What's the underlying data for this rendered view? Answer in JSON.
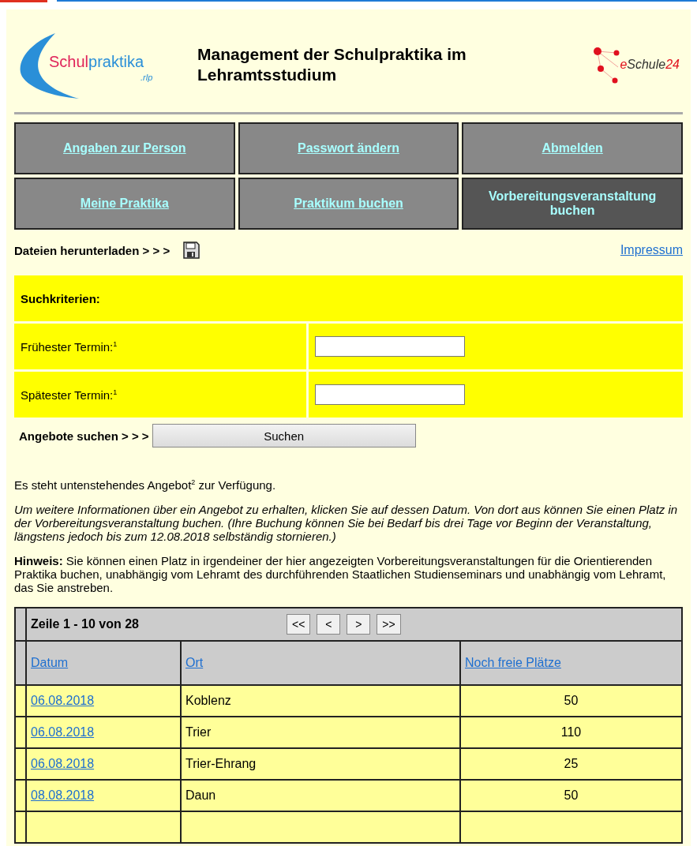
{
  "header": {
    "logo_left": {
      "main_a": "Schul",
      "main_b": "praktika",
      "sub": ".rlp"
    },
    "title": "Management der Schulpraktika im Lehramtsstudium",
    "logo_right": {
      "prefix": "e",
      "name": "Schule",
      "suffix": "24"
    }
  },
  "nav": [
    {
      "label": "Angaben zur Person",
      "selected": false
    },
    {
      "label": "Passwort ändern",
      "selected": false
    },
    {
      "label": "Abmelden",
      "selected": false
    },
    {
      "label": "Meine Praktika",
      "selected": false
    },
    {
      "label": "Praktikum buchen",
      "selected": false
    },
    {
      "label": "Vorbereitungsveranstaltung buchen",
      "selected": true
    }
  ],
  "downloads": {
    "label": "Dateien herunterladen > > >",
    "impressum": "Impressum"
  },
  "search": {
    "heading": "Suchkriterien:",
    "fields": [
      {
        "label": "Frühester Termin:$^{1}$"
      },
      {
        "label": "Spätester Termin:$^{1}$"
      }
    ],
    "action_label": "Angebote suchen > > >",
    "button": "Suchen"
  },
  "info": [
    "Es steht untenstehendes Angebot$^{2}$ zur Verfügung.",
    "*Um weitere Informationen über ein Angebot zu erhalten, klicken Sie auf dessen Datum. Von dort aus können Sie einen Platz in der Vorbereitungsveranstaltung buchen. (Ihre Buchung können Sie bei Bedarf bis drei Tage vor Beginn der Veranstaltung, längstens jedoch bis zum 12.08.2018 selbständig stornieren.)*",
    "**Hinweis:** Sie können einen Platz in irgendeiner der hier angezeigten Vorbereitungsveranstaltungen für die Orientierenden Praktika buchen, unabhängig vom Lehramt des durchführenden Staatlichen Studienseminars und unabhängig vom Lehramt, das Sie anstreben."
  ],
  "table": {
    "range": "Zeile 1 - 10 von 28",
    "pager": [
      "<<",
      "<",
      ">",
      ">>"
    ],
    "columns": [
      "Datum",
      "Ort",
      "Noch freie Plätze"
    ],
    "rows": [
      [
        "06.08.2018",
        "Koblenz",
        "50"
      ],
      [
        "06.08.2018",
        "Trier",
        "110"
      ],
      [
        "06.08.2018",
        "Trier-Ehrang",
        "25"
      ],
      [
        "08.08.2018",
        "Daun",
        "50"
      ]
    ]
  }
}
